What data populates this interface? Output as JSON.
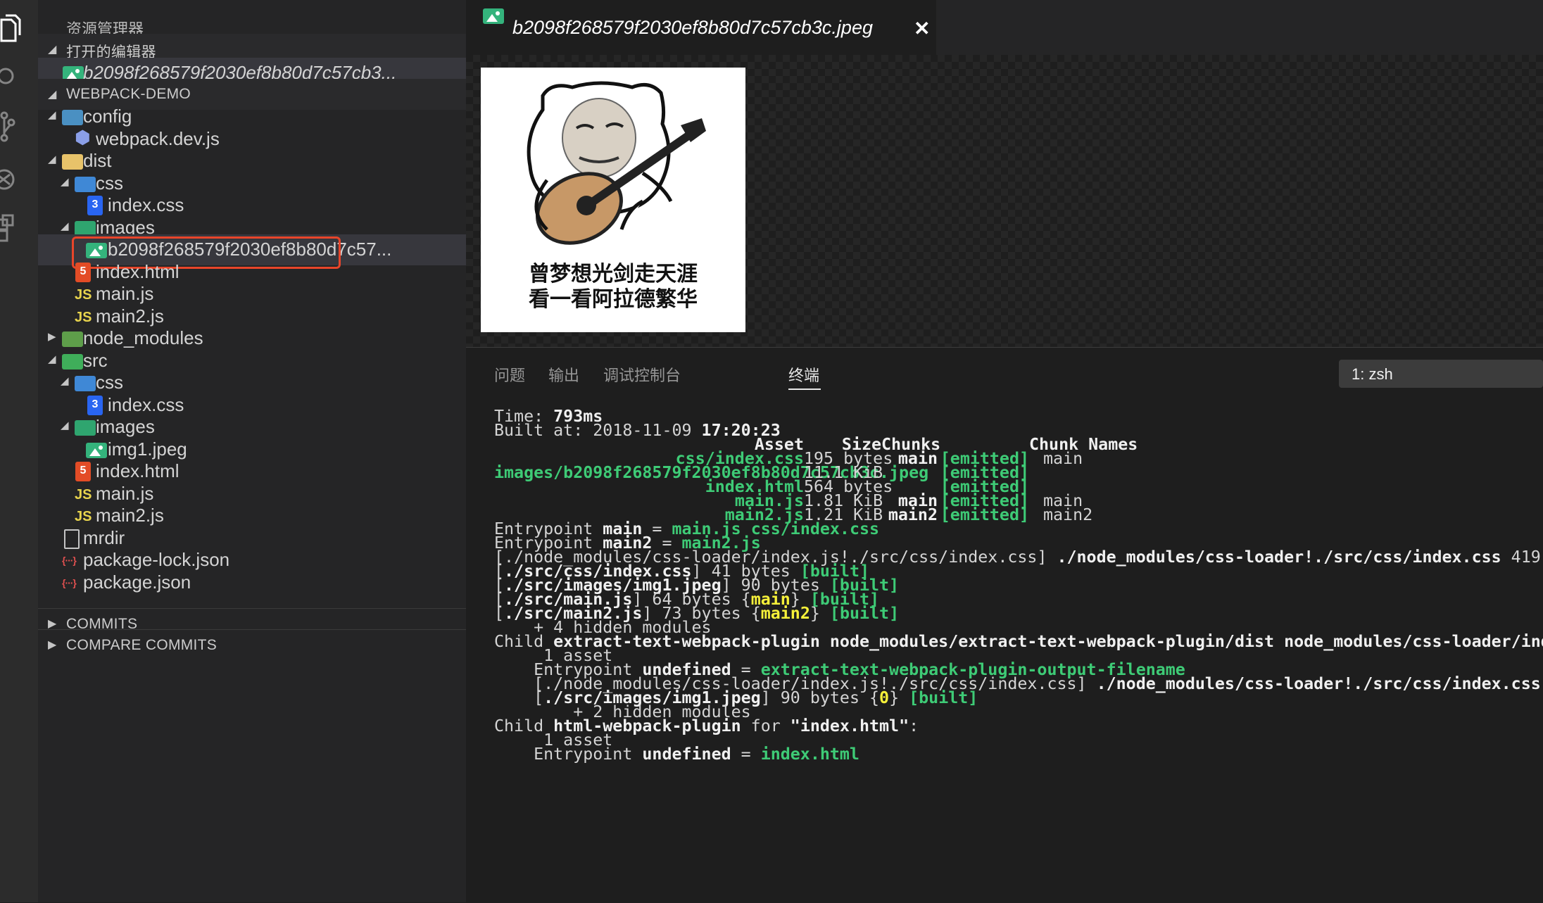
{
  "sidebar": {
    "title": "资源管理器",
    "open_editors": {
      "label": "打开的编辑器",
      "files": [
        "b2098f268579f2030ef8b80d7c57cb3..."
      ]
    },
    "project": {
      "label": "WEBPACK-DEMO",
      "tree": [
        {
          "name": "config",
          "icon": "folder-icon"
        },
        {
          "name": "webpack.dev.js",
          "icon": "webpack-icon"
        },
        {
          "name": "dist",
          "icon": "folder-icon"
        },
        {
          "name": "css",
          "icon": "folder-icon"
        },
        {
          "name": "index.css",
          "icon": "css-icon"
        },
        {
          "name": "images",
          "icon": "folder-icon"
        },
        {
          "name": "b2098f268579f2030ef8b80d7c57...",
          "icon": "image-file-icon"
        },
        {
          "name": "index.html",
          "icon": "html-icon"
        },
        {
          "name": "main.js",
          "icon": "js-icon"
        },
        {
          "name": "main2.js",
          "icon": "js-icon"
        },
        {
          "name": "node_modules",
          "icon": "folder-icon"
        },
        {
          "name": "src",
          "icon": "folder-icon"
        },
        {
          "name": "css",
          "icon": "folder-icon"
        },
        {
          "name": "index.css",
          "icon": "css-icon"
        },
        {
          "name": "images",
          "icon": "folder-icon"
        },
        {
          "name": "img1.jpeg",
          "icon": "image-file-icon"
        },
        {
          "name": "index.html",
          "icon": "html-icon"
        },
        {
          "name": "main.js",
          "icon": "js-icon"
        },
        {
          "name": "main2.js",
          "icon": "js-icon"
        },
        {
          "name": "mrdir",
          "icon": "file-icon"
        },
        {
          "name": "package-lock.json",
          "icon": "json-icon"
        },
        {
          "name": "package.json",
          "icon": "json-icon"
        }
      ]
    },
    "commits_label": "COMMITS",
    "compare_commits_label": "COMPARE COMMITS"
  },
  "editor": {
    "tab": {
      "title": "b2098f268579f2030ef8b80d7c57cb3c.jpeg",
      "close": "✕"
    },
    "image_caption": [
      "曾梦想光剑走天涯",
      "看一看阿拉德繁华"
    ]
  },
  "panel": {
    "tabs": [
      "问题",
      "输出",
      "调试控制台",
      "终端"
    ],
    "active_tab": "终端",
    "terminal_selector": "1: zsh"
  },
  "terminal": {
    "time_label": "Time: ",
    "time_value": "793ms",
    "built_label": "Built at: 2018-11-09 ",
    "built_time": "17:20:23",
    "header": {
      "asset": "Asset",
      "size": "Size",
      "chunks": "Chunks",
      "chunk_names": "Chunk Names"
    },
    "assets": [
      {
        "asset": "css/index.css",
        "size": "195 bytes",
        "chunks": "main",
        "status": "[emitted]",
        "names": "main"
      },
      {
        "asset": "images/b2098f268579f2030ef8b80d7c57cb3c.jpeg",
        "size": "11.1 KiB",
        "chunks": "",
        "status": "[emitted]",
        "names": ""
      },
      {
        "asset": "index.html",
        "size": "564 bytes",
        "chunks": "",
        "status": "[emitted]",
        "names": ""
      },
      {
        "asset": "main.js",
        "size": "1.81 KiB",
        "chunks": "main",
        "status": "[emitted]",
        "names": "main"
      },
      {
        "asset": "main2.js",
        "size": "1.21 KiB",
        "chunks": "main2",
        "status": "[emitted]",
        "names": "main2"
      }
    ],
    "lines": {
      "ep1": [
        "Entrypoint ",
        "main",
        " = ",
        "main.js css/index.css"
      ],
      "ep2": [
        "Entrypoint ",
        "main2",
        " = ",
        "main2.js"
      ],
      "m1": [
        "[./node_modules/css-loader/index.js!./src/css/index.css] ",
        "./node_modules/css-loader!./src/css/index.css",
        " 419"
      ],
      "m2": [
        "[",
        "./src/css/index.css",
        "] 41 bytes ",
        "[built]"
      ],
      "m3": [
        "[",
        "./src/images/img1.jpeg",
        "] 90 bytes ",
        "[built]"
      ],
      "m4": [
        "[",
        "./src/main.js",
        "] 64 bytes {",
        "main",
        "} ",
        "[built]"
      ],
      "m5": [
        "[",
        "./src/main2.js",
        "] 73 bytes {",
        "main2",
        "} ",
        "[built]"
      ],
      "m6": "    + 4 hidden modules",
      "c1": [
        "Child ",
        "extract-text-webpack-plugin",
        " ",
        "node_modules/extract-text-webpack-plugin/dist",
        " ",
        "node_modules/css-loader/ind"
      ],
      "c2": "     1 asset",
      "c3": [
        "    Entrypoint ",
        "undefined",
        " = ",
        "extract-text-webpack-plugin-output-filename"
      ],
      "c4": [
        "    [./node_modules/css-loader/index.js!./src/css/index.css] ",
        "./node_modules/css-loader!./src/css/index.css"
      ],
      "c5": [
        "    [",
        "./src/images/img1.jpeg",
        "] 90 bytes {",
        "0",
        "} ",
        "[built]"
      ],
      "c6": "        + 2 hidden modules",
      "h1": [
        "Child ",
        "html-webpack-plugin",
        " for ",
        "\"index.html\"",
        ":"
      ],
      "h2": "     1 asset",
      "h3": [
        "    Entrypoint ",
        "undefined",
        " = ",
        "index.html"
      ]
    }
  }
}
